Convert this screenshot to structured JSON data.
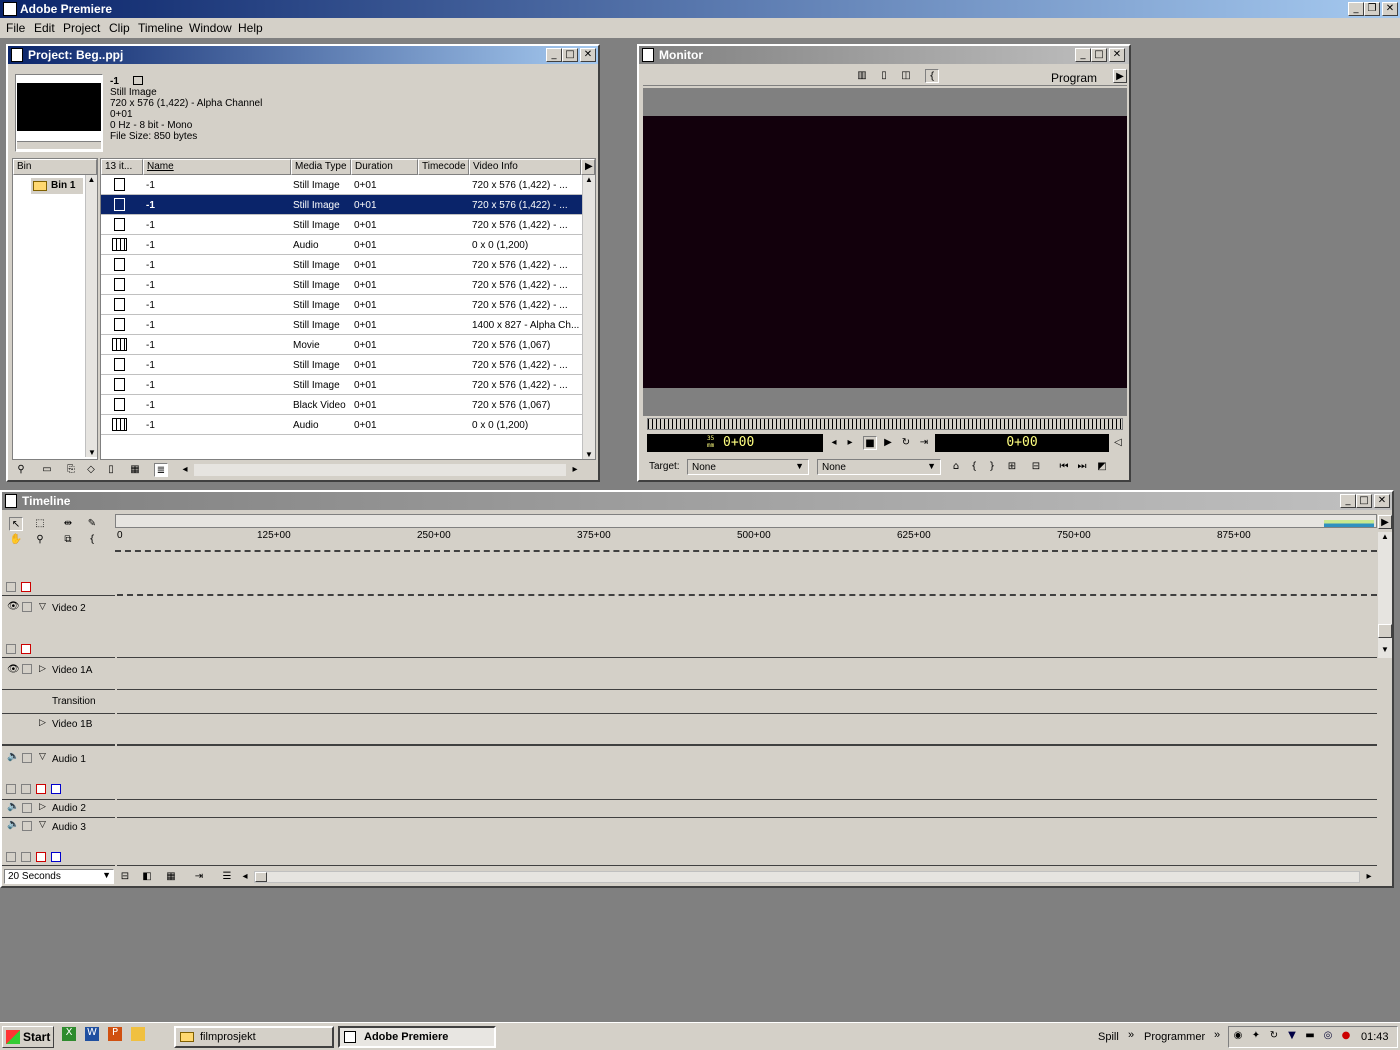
{
  "app": {
    "title": "Adobe Premiere"
  },
  "menu": [
    "File",
    "Edit",
    "Project",
    "Clip",
    "Timeline",
    "Window",
    "Help"
  ],
  "project": {
    "title": "Project: Beg..ppj",
    "preview": {
      "name": "-1",
      "type": "Still Image",
      "dims": "720 x 576 (1,422) - Alpha Channel",
      "duration": "0+01",
      "audio": "0 Hz - 8 bit - Mono",
      "size": "File Size: 850 bytes"
    },
    "bin_header": "Bin",
    "bin_item": "Bin 1",
    "columns": [
      "13 it...",
      "Name",
      "Media Type",
      "Duration",
      "Timecode",
      "Video Info"
    ],
    "rows": [
      {
        "name": "-1",
        "type": "Still Image",
        "dur": "0+01",
        "info": "720 x 576 (1,422) - ...",
        "icon": "document-icon"
      },
      {
        "name": "-1",
        "type": "Still Image",
        "dur": "0+01",
        "info": "720 x 576 (1,422) - ...",
        "icon": "document-icon"
      },
      {
        "name": "-1",
        "type": "Still Image",
        "dur": "0+01",
        "info": "720 x 576 (1,422) - ...",
        "icon": "document-icon"
      },
      {
        "name": "-1",
        "type": "Audio",
        "dur": "0+01",
        "info": "0 x 0 (1,200)",
        "icon": "film-icon"
      },
      {
        "name": "-1",
        "type": "Still Image",
        "dur": "0+01",
        "info": "720 x 576 (1,422) - ...",
        "icon": "document-icon"
      },
      {
        "name": "-1",
        "type": "Still Image",
        "dur": "0+01",
        "info": "720 x 576 (1,422) - ...",
        "icon": "document-icon"
      },
      {
        "name": "-1",
        "type": "Still Image",
        "dur": "0+01",
        "info": "720 x 576 (1,422) - ...",
        "icon": "document-icon"
      },
      {
        "name": "-1",
        "type": "Still Image",
        "dur": "0+01",
        "info": "1400 x 827 - Alpha Ch...",
        "icon": "document-icon"
      },
      {
        "name": "-1",
        "type": "Movie",
        "dur": "0+01",
        "info": "720 x 576 (1,067)",
        "icon": "film-icon"
      },
      {
        "name": "-1",
        "type": "Still Image",
        "dur": "0+01",
        "info": "720 x 576 (1,422) - ...",
        "icon": "document-icon"
      },
      {
        "name": "-1",
        "type": "Still Image",
        "dur": "0+01",
        "info": "720 x 576 (1,422) - ...",
        "icon": "document-icon"
      },
      {
        "name": "-1",
        "type": "Black Video",
        "dur": "0+01",
        "info": "720 x 576 (1,067)",
        "icon": "document-icon"
      },
      {
        "name": "-1",
        "type": "Audio",
        "dur": "0+01",
        "info": "0 x 0 (1,200)",
        "icon": "film-icon"
      }
    ],
    "selected_row": 1
  },
  "monitor": {
    "title": "Monitor",
    "mode": "Program",
    "tc_left_prefix": "35 mm",
    "tc_left": "0+00",
    "tc_right": "0+00",
    "target_label": "Target:",
    "target_video": "None",
    "target_audio": "None"
  },
  "timeline": {
    "title": "Timeline",
    "ruler": [
      "0",
      "125+00",
      "250+00",
      "375+00",
      "500+00",
      "625+00",
      "750+00",
      "875+00"
    ],
    "tracks": [
      "Video 2",
      "Video 1A",
      "Transition",
      "Video 1B",
      "Audio 1",
      "Audio 2",
      "Audio 3"
    ],
    "zoom": "20 Seconds"
  },
  "taskbar": {
    "start": "Start",
    "tasks": [
      "filmprosjekt",
      "Adobe Premiere"
    ],
    "toolbar1": "Spill",
    "toolbar2": "Programmer",
    "clock": "01:43"
  }
}
